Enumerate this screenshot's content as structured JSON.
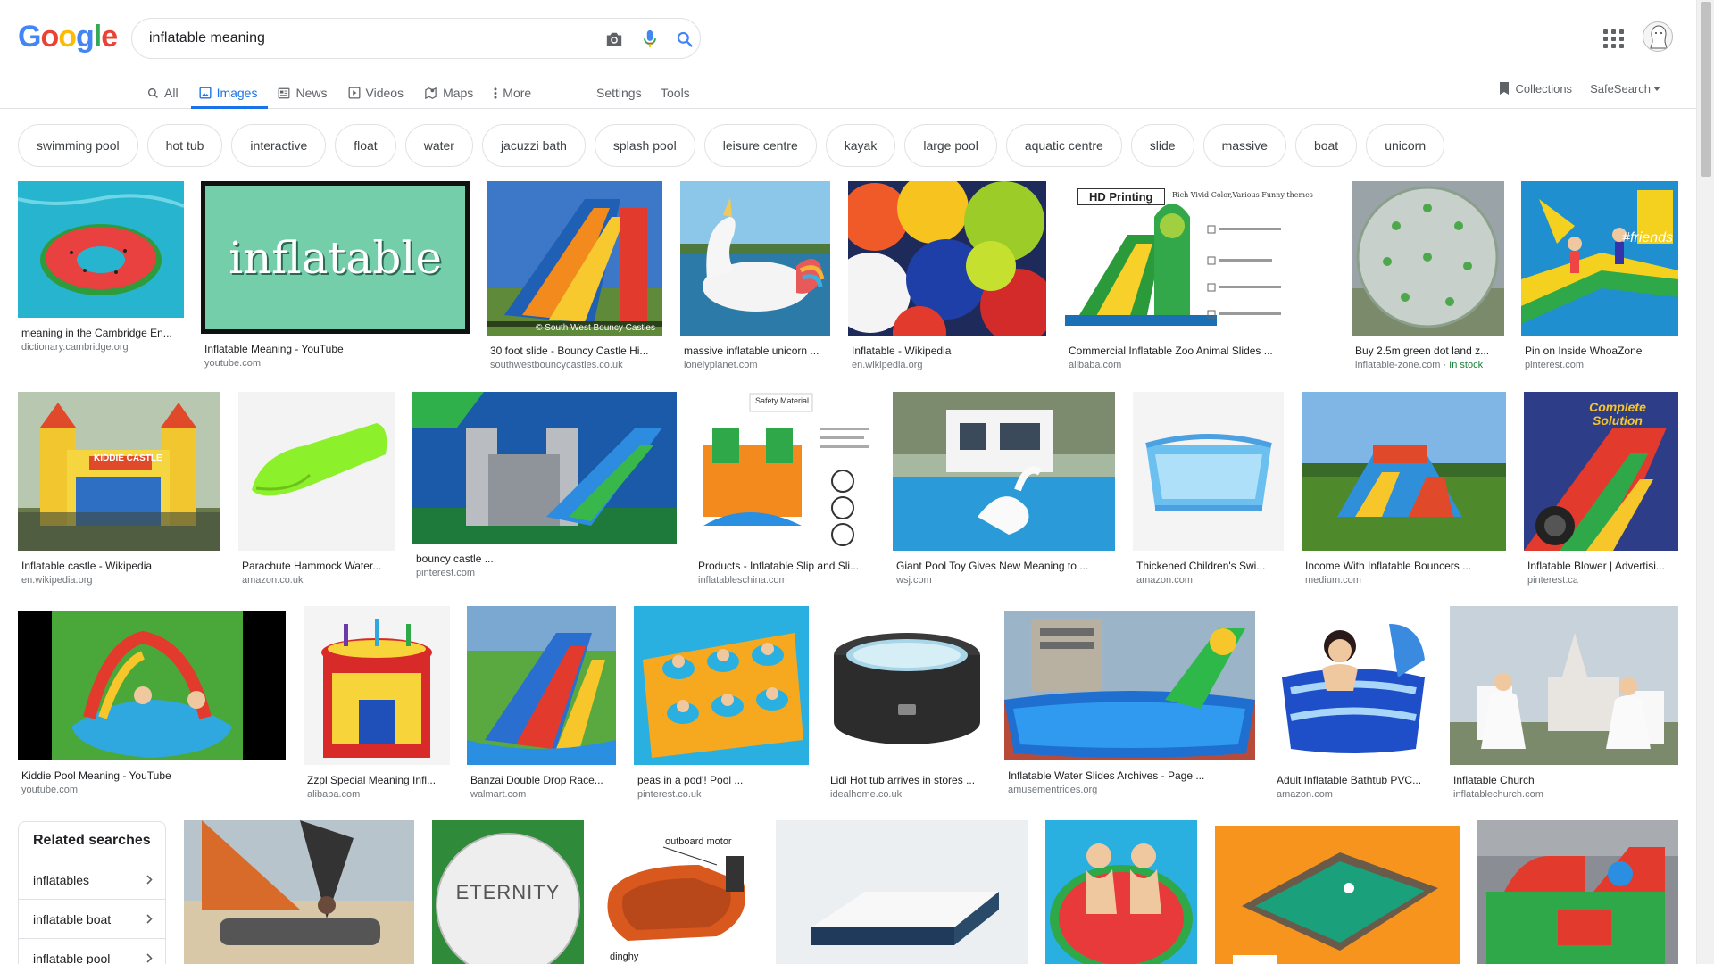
{
  "search": {
    "query": "inflatable meaning"
  },
  "logo": {
    "letters": [
      "G",
      "o",
      "o",
      "g",
      "l",
      "e"
    ],
    "colors": [
      "#4285f4",
      "#ea4335",
      "#fbbc05",
      "#4285f4",
      "#34a853",
      "#ea4335"
    ]
  },
  "tabs": [
    {
      "label": "All",
      "icon": "search-icon"
    },
    {
      "label": "Images",
      "icon": "image-icon",
      "active": true
    },
    {
      "label": "News",
      "icon": "news-icon"
    },
    {
      "label": "Videos",
      "icon": "video-icon"
    },
    {
      "label": "Maps",
      "icon": "map-icon"
    },
    {
      "label": "More",
      "icon": "more-icon"
    }
  ],
  "settings_label": "Settings",
  "tools_label": "Tools",
  "collections_label": "Collections",
  "safesearch_label": "SafeSearch",
  "chips": [
    "swimming pool",
    "hot tub",
    "interactive",
    "float",
    "water",
    "jacuzzi bath",
    "splash pool",
    "leisure centre",
    "kayak",
    "large pool",
    "aquatic centre",
    "slide",
    "massive",
    "boat",
    "unicorn"
  ],
  "rows": [
    [
      {
        "caption": "meaning in the Cambridge En...",
        "source": "dictionary.cambridge.org"
      },
      {
        "caption": "Inflatable Meaning - YouTube",
        "source": "youtube.com",
        "overlay": "inflatable"
      },
      {
        "caption": "30 foot slide - Bouncy Castle Hi...",
        "source": "southwestbouncycastles.co.uk",
        "overlay": "© South West Bouncy Castles"
      },
      {
        "caption": "massive inflatable unicorn ...",
        "source": "lonelyplanet.com"
      },
      {
        "caption": "Inflatable - Wikipedia",
        "source": "en.wikipedia.org"
      },
      {
        "caption": "Commercial Inflatable Zoo Animal Slides ...",
        "source": "alibaba.com",
        "overlay": "HD Printing",
        "overlay2": "Rich Vivid Color,Various Funny themes"
      },
      {
        "caption": "Buy 2.5m green dot land z...",
        "source": "inflatable-zone.com",
        "stock": "In stock"
      },
      {
        "caption": "Pin on Inside WhoaZone",
        "source": "pinterest.com",
        "overlay": "#friends"
      }
    ],
    [
      {
        "caption": "Inflatable castle - Wikipedia",
        "source": "en.wikipedia.org",
        "overlay": "KIDDIE CASTLE"
      },
      {
        "caption": "Parachute Hammock Water...",
        "source": "amazon.co.uk"
      },
      {
        "caption": "bouncy castle ...",
        "source": "pinterest.com"
      },
      {
        "caption": "Products - Inflatable Slip and Sli...",
        "source": "inflatableschina.com",
        "overlay": "Safety Material"
      },
      {
        "caption": "Giant Pool Toy Gives New Meaning to ...",
        "source": "wsj.com"
      },
      {
        "caption": "Thickened Children's Swi...",
        "source": "amazon.com"
      },
      {
        "caption": "Income With Inflatable Bouncers ...",
        "source": "medium.com"
      },
      {
        "caption": "Inflatable Blower | Advertisi...",
        "source": "pinterest.ca",
        "overlay": "Complete Solution"
      }
    ],
    [
      {
        "caption": "Kiddie Pool Meaning - YouTube",
        "source": "youtube.com"
      },
      {
        "caption": "Zzpl Special Meaning Infl...",
        "source": "alibaba.com"
      },
      {
        "caption": "Banzai Double Drop Race...",
        "source": "walmart.com"
      },
      {
        "caption": "peas in a pod'! Pool ...",
        "source": "pinterest.co.uk"
      },
      {
        "caption": "Lidl Hot tub arrives in stores ...",
        "source": "idealhome.co.uk"
      },
      {
        "caption": "Inflatable Water Slides Archives - Page ...",
        "source": "amusementrides.org"
      },
      {
        "caption": "Adult Inflatable Bathtub PVC...",
        "source": "amazon.com"
      },
      {
        "caption": "Inflatable Church",
        "source": "inflatablechurch.com"
      }
    ],
    [
      {
        "caption": "",
        "source": ""
      },
      {
        "caption": "",
        "source": "",
        "overlay": "ETERNITY"
      },
      {
        "caption": "",
        "source": "",
        "overlay": "outboard motor",
        "overlay2": "dinghy"
      },
      {
        "caption": "",
        "source": ""
      },
      {
        "caption": "",
        "source": ""
      },
      {
        "caption": "",
        "source": ""
      },
      {
        "caption": "",
        "source": ""
      }
    ]
  ],
  "related": {
    "title": "Related searches",
    "items": [
      "inflatables",
      "inflatable boat",
      "inflatable pool"
    ]
  }
}
